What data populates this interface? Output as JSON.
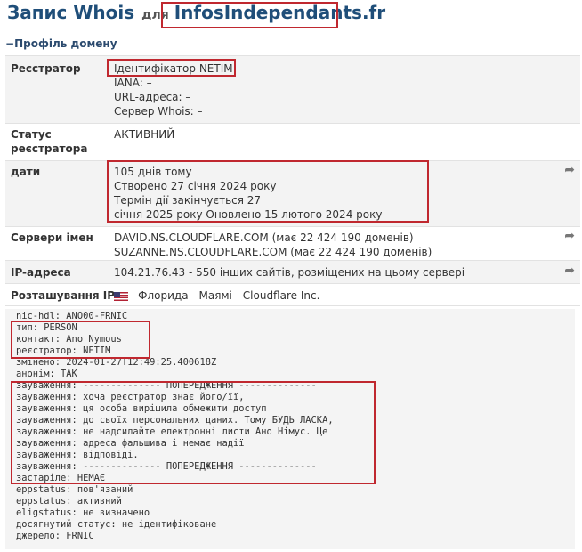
{
  "header": {
    "title": "Запис Whois",
    "preposition": "для",
    "domain": "InfosIndependants.fr"
  },
  "section": {
    "toggle": "−",
    "title": "Профіль домену"
  },
  "rows": {
    "registrar": {
      "label": "Реєстратор",
      "lines": [
        "Ідентифікатор NETIM",
        "IANA: –",
        "URL-адреса: –",
        "Сервер Whois: –"
      ]
    },
    "status": {
      "label_lines": [
        "Статус",
        "реєстратора"
      ],
      "value": "АКТИВНИЙ"
    },
    "dates": {
      "label": "дати",
      "lines": [
        "105 днів тому",
        "Створено 27 січня 2024 року",
        "Термін дії закінчується 27",
        "січня 2025 року Оновлено 15 лютого 2024 року"
      ]
    },
    "nameservers": {
      "label": "Сервери імен",
      "lines": [
        "DAVID.NS.CLOUDFLARE.COM (має 22 424 190 доменів)",
        "SUZANNE.NS.CLOUDFLARE.COM (має 22 424 190 доменів)"
      ]
    },
    "ip": {
      "label": "IP-адреса",
      "value": "104.21.76.43 - 550 інших сайтів, розміщених на цьому сервері"
    },
    "location": {
      "label": "Розташування IP",
      "value": "- Флорида - Маямі - Cloudflare Inc."
    }
  },
  "raw_lines": [
    "nic-hdl: ANO00-FRNIC",
    "тип: PERSON",
    "контакт: Ano Nymous",
    "реєстратор: NETIM",
    "змінено: 2024-01-27T12:49:25.400618Z",
    "анонім: ТАК",
    "зауваження: -------------- ПОПЕРЕДЖЕННЯ --------------",
    "зауваження: хоча реєстратор знає його/її,",
    "зауваження: ця особа вирішила обмежити доступ",
    "зауваження: до своїх персональних даних. Тому БУДЬ ЛАСКА,",
    "зауваження: не надсилайте електронні листи Ано Німус. Це",
    "зауваження: адреса фальшива і немає надії",
    "зауваження: відповіді.",
    "зауваження: -------------- ПОПЕРЕДЖЕННЯ --------------",
    "застаріле: НЕМАЄ",
    "eppstatus: пов'язаний",
    "eppstatus: активний",
    "eligstatus: не визначено",
    "досягнутий статус: не ідентифіковане",
    "джерело: FRNIC"
  ],
  "icons": {
    "share": "share-arrow-icon",
    "flag": "us-flag-icon"
  }
}
